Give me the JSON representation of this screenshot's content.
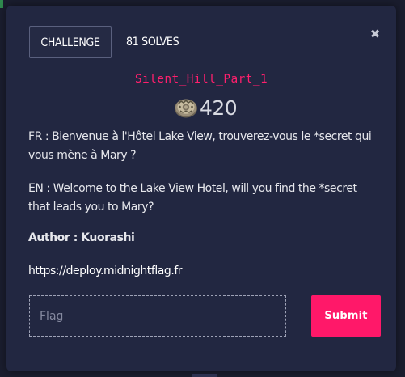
{
  "modal": {
    "tabs": [
      {
        "label": "CHALLENGE"
      },
      {
        "label": "81 SOLVES"
      }
    ],
    "close_icon": "✖"
  },
  "challenge": {
    "name": "Silent_Hill_Part_1",
    "points": "420",
    "points_icon": "coin-icon",
    "description_fr": "FR : Bienvenue à l'Hôtel Lake View, trouverez-vous le *secret qui vous mène à Mary ?",
    "description_en": "EN : Welcome to the Lake View Hotel, will you find the *secret that leads you to Mary?",
    "author": "Author : Kuorashi",
    "link": "https://deploy.midnightflag.fr"
  },
  "form": {
    "flag_placeholder": "Flag",
    "flag_value": "",
    "submit_label": "Submit"
  },
  "colors": {
    "page_background": "#1a1d2e",
    "modal_background": "#222741",
    "accent": "#ff1869",
    "title": "#ff1f6d",
    "text": "#e6e7ec"
  }
}
